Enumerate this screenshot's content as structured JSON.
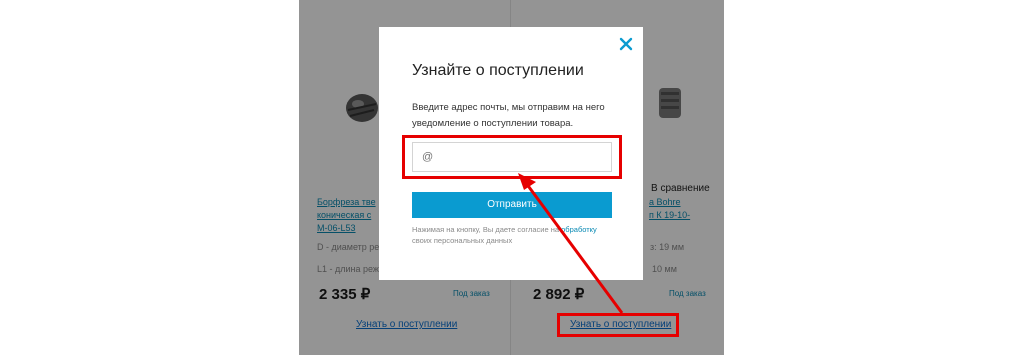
{
  "products": [
    {
      "title": "Борфреза твердосплавная коническая с ... М-06-L53",
      "title_lines": [
        "Борфреза тве",
        "коническая с",
        "М-06-L53"
      ],
      "spec_d": "D - диаметр ре",
      "spec_l1": "L1 - длина реж",
      "price": "2 335 ₽",
      "availability": "Под заказ",
      "notify_link": "Узнать о поступлении"
    },
    {
      "compare": "В сравнение",
      "title_lines": [
        "а Bohre",
        "п К 19-10-"
      ],
      "spec_d": "з: 19 мм",
      "spec_l1": "10 мм",
      "price": "2 892 ₽",
      "availability": "Под заказ",
      "notify_link": "Узнать о поступлении"
    }
  ],
  "modal": {
    "title": "Узнайте о поступлении",
    "description": "Введите адрес почты, мы отправим на него уведомление о поступлении товара.",
    "email_placeholder": "@",
    "submit_label": "Отправить",
    "consent_text": "Нажимая на кнопку, Вы даете согласие на",
    "consent_link": "обработку",
    "consent_tail": "своих персональных данных",
    "close_icon": "close-icon"
  },
  "colors": {
    "accent": "#0a9bd0",
    "link": "#0a8ab4",
    "highlight": "#e60000",
    "overlay": "rgba(0,0,0,0.42)"
  }
}
